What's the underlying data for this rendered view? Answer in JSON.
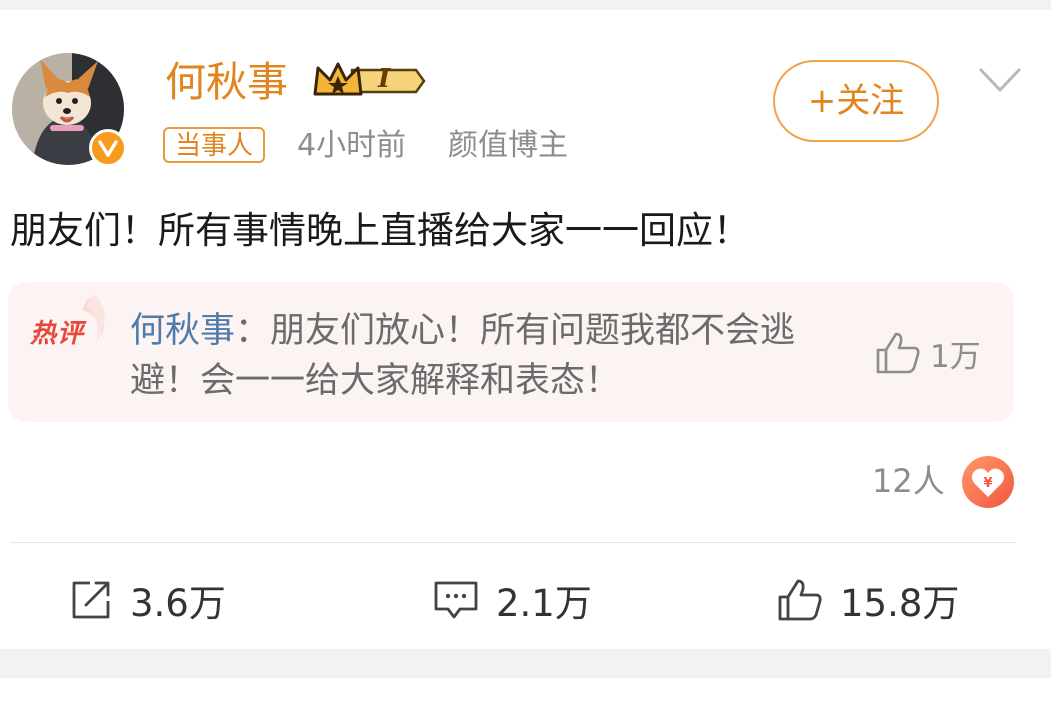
{
  "post": {
    "author": {
      "name": "何秋事",
      "level": "I",
      "tag": "当事人",
      "time": "4小时前",
      "label": "颜值博主"
    },
    "follow_label": "+关注",
    "content": "朋友们！所有事情晚上直播给大家一一回应！",
    "hot_comment": {
      "badge": "热评",
      "user": "何秋事",
      "separator": "：",
      "text": "朋友们放心！所有问题我都不会逃避！会一一给大家解释和表态！",
      "likes": "1万"
    },
    "reward_count": "12人",
    "actions": {
      "repost": "3.6万",
      "comment": "2.1万",
      "like": "15.8万"
    }
  },
  "colors": {
    "accent": "#e0851f",
    "hot_red": "#e8483a",
    "link_blue": "#4f7cab",
    "meta_gray": "#8d8d8d"
  },
  "icons": [
    "verified-icon",
    "crown-vip-icon",
    "chevron-down-icon",
    "thumb-up-icon",
    "repost-icon",
    "comment-icon",
    "reward-heart-icon"
  ]
}
